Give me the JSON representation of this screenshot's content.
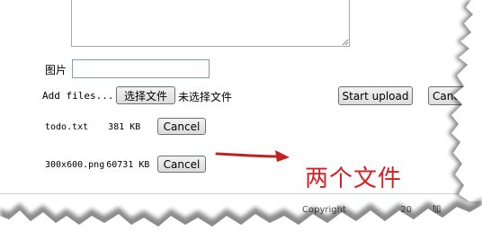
{
  "form": {
    "image_label": "图片",
    "image_value": ""
  },
  "upload": {
    "add_files_label": "Add files...",
    "choose_button": "选择文件",
    "no_file_text": "未选择文件",
    "start_upload_button": "Start upload",
    "cancel_all_button": "Cancel"
  },
  "files": [
    {
      "name": "todo.txt",
      "size": "381 KB",
      "cancel_label": "Cancel"
    },
    {
      "name": "300x600.png",
      "size": "60731 KB",
      "cancel_label": "Cancel"
    }
  ],
  "annotation": {
    "text": "两个文件",
    "color": "#d42020"
  },
  "footer": {
    "copyright_text": "Copyright",
    "year_fragment": "20",
    "trailing_fragment": "加"
  }
}
